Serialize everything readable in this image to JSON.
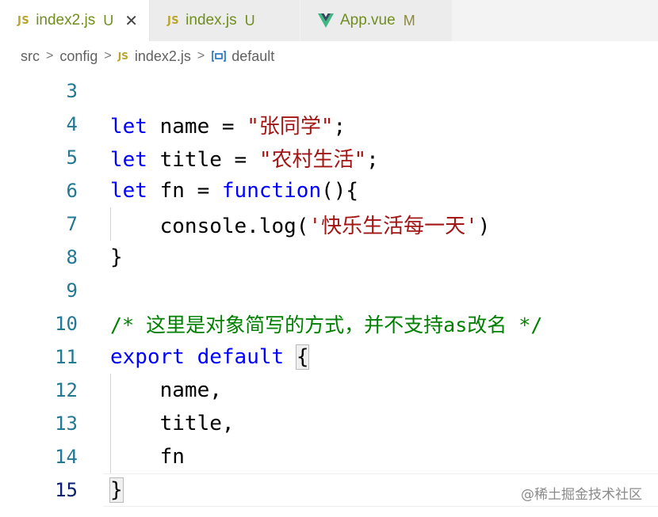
{
  "tabs": [
    {
      "icon": "JS",
      "name": "index2.js",
      "badge": "U",
      "close": "✕",
      "active": true
    },
    {
      "icon": "JS",
      "name": "index.js",
      "badge": "U",
      "active": false
    },
    {
      "icon": "vue-icon",
      "name": "App.vue",
      "badge": "M",
      "active": false
    }
  ],
  "breadcrumb": {
    "items": [
      "src",
      "config",
      "index2.js",
      "default"
    ],
    "file_icon": "JS",
    "separator": ">"
  },
  "editor": {
    "active_line": 15,
    "lines": [
      {
        "number": "3"
      },
      {
        "number": "4"
      },
      {
        "number": "5"
      },
      {
        "number": "6"
      },
      {
        "number": "7"
      },
      {
        "number": "8"
      },
      {
        "number": "9"
      },
      {
        "number": "10"
      },
      {
        "number": "11"
      },
      {
        "number": "12"
      },
      {
        "number": "13"
      },
      {
        "number": "14"
      },
      {
        "number": "15"
      }
    ],
    "tokens": {
      "l4_kw": "let",
      "l4_a": " name = ",
      "l4_str": "\"张同学\"",
      "l4_b": ";",
      "l5_kw": "let",
      "l5_a": " title = ",
      "l5_str": "\"农村生活\"",
      "l5_b": ";",
      "l6_kw": "let",
      "l6_a": " fn = ",
      "l6_kw2": "function",
      "l6_b": "(){",
      "l7_a": "    console.log(",
      "l7_str": "'快乐生活每一天'",
      "l7_b": ")",
      "l8_a": "}",
      "l10_cmt": "/* 这里是对象简写的方式，并不支持as改名 */",
      "l11_kw": "export",
      "l11_sp": " ",
      "l11_kw2": "default",
      "l11_sp2": " ",
      "l11_b": "{",
      "l12_a": "    name,",
      "l13_a": "    title,",
      "l14_a": "    fn",
      "l15_a": "}"
    }
  },
  "watermark": "@稀土掘金技术社区",
  "colors": {
    "keyword": "#0000ff",
    "string": "#a31515",
    "comment": "#008000",
    "line_number": "#237893",
    "git_untracked": "#6f8e1f"
  }
}
